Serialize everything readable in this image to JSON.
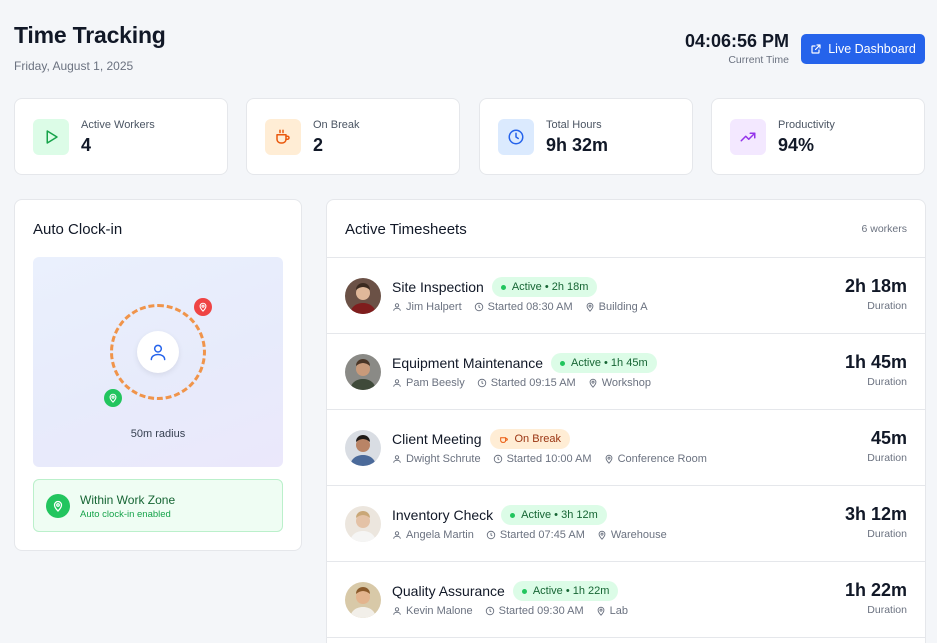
{
  "header": {
    "title": "Time Tracking",
    "date": "Friday, August 1, 2025",
    "current_time": "04:06:56 PM",
    "current_time_label": "Current Time",
    "live_dashboard_label": "Live Dashboard"
  },
  "stats": [
    {
      "label": "Active Workers",
      "value": "4",
      "icon": "play-icon",
      "color": "#16a34a",
      "bg": "#dcfce7"
    },
    {
      "label": "On Break",
      "value": "2",
      "icon": "coffee-icon",
      "color": "#ea580c",
      "bg": "#ffedd5"
    },
    {
      "label": "Total Hours",
      "value": "9h 32m",
      "icon": "clock-icon",
      "color": "#2563eb",
      "bg": "#dbeafe"
    },
    {
      "label": "Productivity",
      "value": "94%",
      "icon": "trending-up-icon",
      "color": "#9333ea",
      "bg": "#f3e8ff"
    }
  ],
  "auto_clock": {
    "title": "Auto Clock-in",
    "radius_label": "50m radius",
    "zone_title": "Within Work Zone",
    "zone_subtitle": "Auto clock-in enabled"
  },
  "timesheets": {
    "title": "Active Timesheets",
    "count_label": "6 workers",
    "duration_label": "Duration",
    "rows": [
      {
        "job": "Site Inspection",
        "status": "Active • 2h 18m",
        "status_type": "active",
        "worker": "Jim Halpert",
        "started": "Started 08:30 AM",
        "location": "Building A",
        "duration": "2h 18m"
      },
      {
        "job": "Equipment Maintenance",
        "status": "Active • 1h 45m",
        "status_type": "active",
        "worker": "Pam Beesly",
        "started": "Started 09:15 AM",
        "location": "Workshop",
        "duration": "1h 45m"
      },
      {
        "job": "Client Meeting",
        "status": "On Break",
        "status_type": "break",
        "worker": "Dwight Schrute",
        "started": "Started 10:00 AM",
        "location": "Conference Room",
        "duration": "45m"
      },
      {
        "job": "Inventory Check",
        "status": "Active • 3h 12m",
        "status_type": "active",
        "worker": "Angela Martin",
        "started": "Started 07:45 AM",
        "location": "Warehouse",
        "duration": "3h 12m"
      },
      {
        "job": "Quality Assurance",
        "status": "Active • 1h 22m",
        "status_type": "active",
        "worker": "Kevin Malone",
        "started": "Started 09:30 AM",
        "location": "Lab",
        "duration": "1h 22m"
      }
    ]
  },
  "colors": {
    "accent": "#2563eb",
    "ring": "#f0944a",
    "active_green": "#22c55e",
    "pin_red": "#ef4444"
  }
}
